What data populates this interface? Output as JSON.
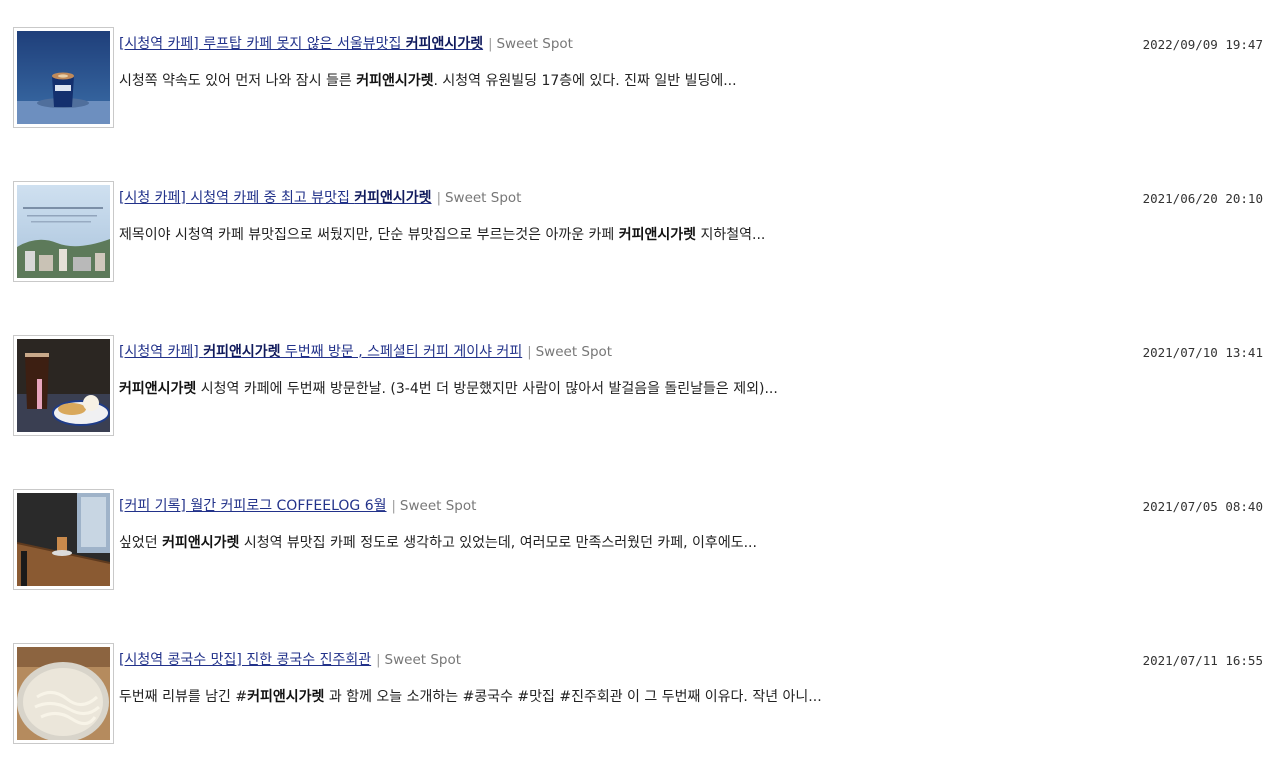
{
  "results": [
    {
      "title_pre": "[시청역 카페] 루프탑 카페 못지 않은 서울뷰맛집 ",
      "title_bold": "커피앤시가렛",
      "title_post": "",
      "separator": "|",
      "source": "Sweet Spot",
      "date": "2022/09/09 19:47",
      "snippet_pre": "시청쪽 약속도 있어 먼저 나와 잠시 들른 ",
      "snippet_bold": "커피앤시가렛",
      "snippet_post": ". 시청역 유원빌딩 17층에 있다. 진짜 일반 빌딩에...",
      "thumb_icon": "coffee-cup-photo"
    },
    {
      "title_pre": "[시청 카페] 시청역 카페 중 최고 뷰맛집 ",
      "title_bold": "커피앤시가렛",
      "title_post": "",
      "separator": "|",
      "source": "Sweet Spot",
      "date": "2021/06/20 20:10",
      "snippet_pre": "제목이야 시청역 카페 뷰맛집으로 써뒀지만, 단순 뷰맛집으로 부르는것은 아까운 카페 ",
      "snippet_bold": "커피앤시가렛",
      "snippet_post": " 지하철역...",
      "thumb_icon": "city-view-window-photo"
    },
    {
      "title_pre": "[시청역 카페] ",
      "title_bold": "커피앤시가렛",
      "title_post": " 두번째 방문 , 스페셜티 커피 게이샤 커피",
      "separator": "|",
      "source": "Sweet Spot",
      "date": "2021/07/10 13:41",
      "snippet_pre": "",
      "snippet_bold": "커피앤시가렛",
      "snippet_post": " 시청역 카페에 두번째 방문한날. (3-4번 더 방문했지만 사람이 많아서 발걸음을 돌린날들은 제외)...",
      "thumb_icon": "iced-coffee-dessert-photo"
    },
    {
      "title_pre": "[커피 기록] 월간 커피로그 COFFEELOG 6월",
      "title_bold": "",
      "title_post": "",
      "separator": "|",
      "source": "Sweet Spot",
      "date": "2021/07/05 08:40",
      "snippet_pre": "싶었던 ",
      "snippet_bold": "커피앤시가렛",
      "snippet_post": " 시청역 뷰맛집 카페 정도로 생각하고 있었는데, 여러모로 만족스러웠던 카페, 이후에도...",
      "thumb_icon": "cafe-table-photo"
    },
    {
      "title_pre": "[시청역 콩국수 맛집] 진한 콩국수 진주회관",
      "title_bold": "",
      "title_post": "",
      "separator": "|",
      "source": "Sweet Spot",
      "date": "2021/07/11 16:55",
      "snippet_pre": "두번째 리뷰를 남긴 #",
      "snippet_bold": "커피앤시가렛",
      "snippet_post": " 과 함께 오늘 소개하는 #콩국수 #맛집 #진주회관 이 그 두번째 이유다. 작년 아니...",
      "thumb_icon": "noodle-soup-photo"
    }
  ]
}
